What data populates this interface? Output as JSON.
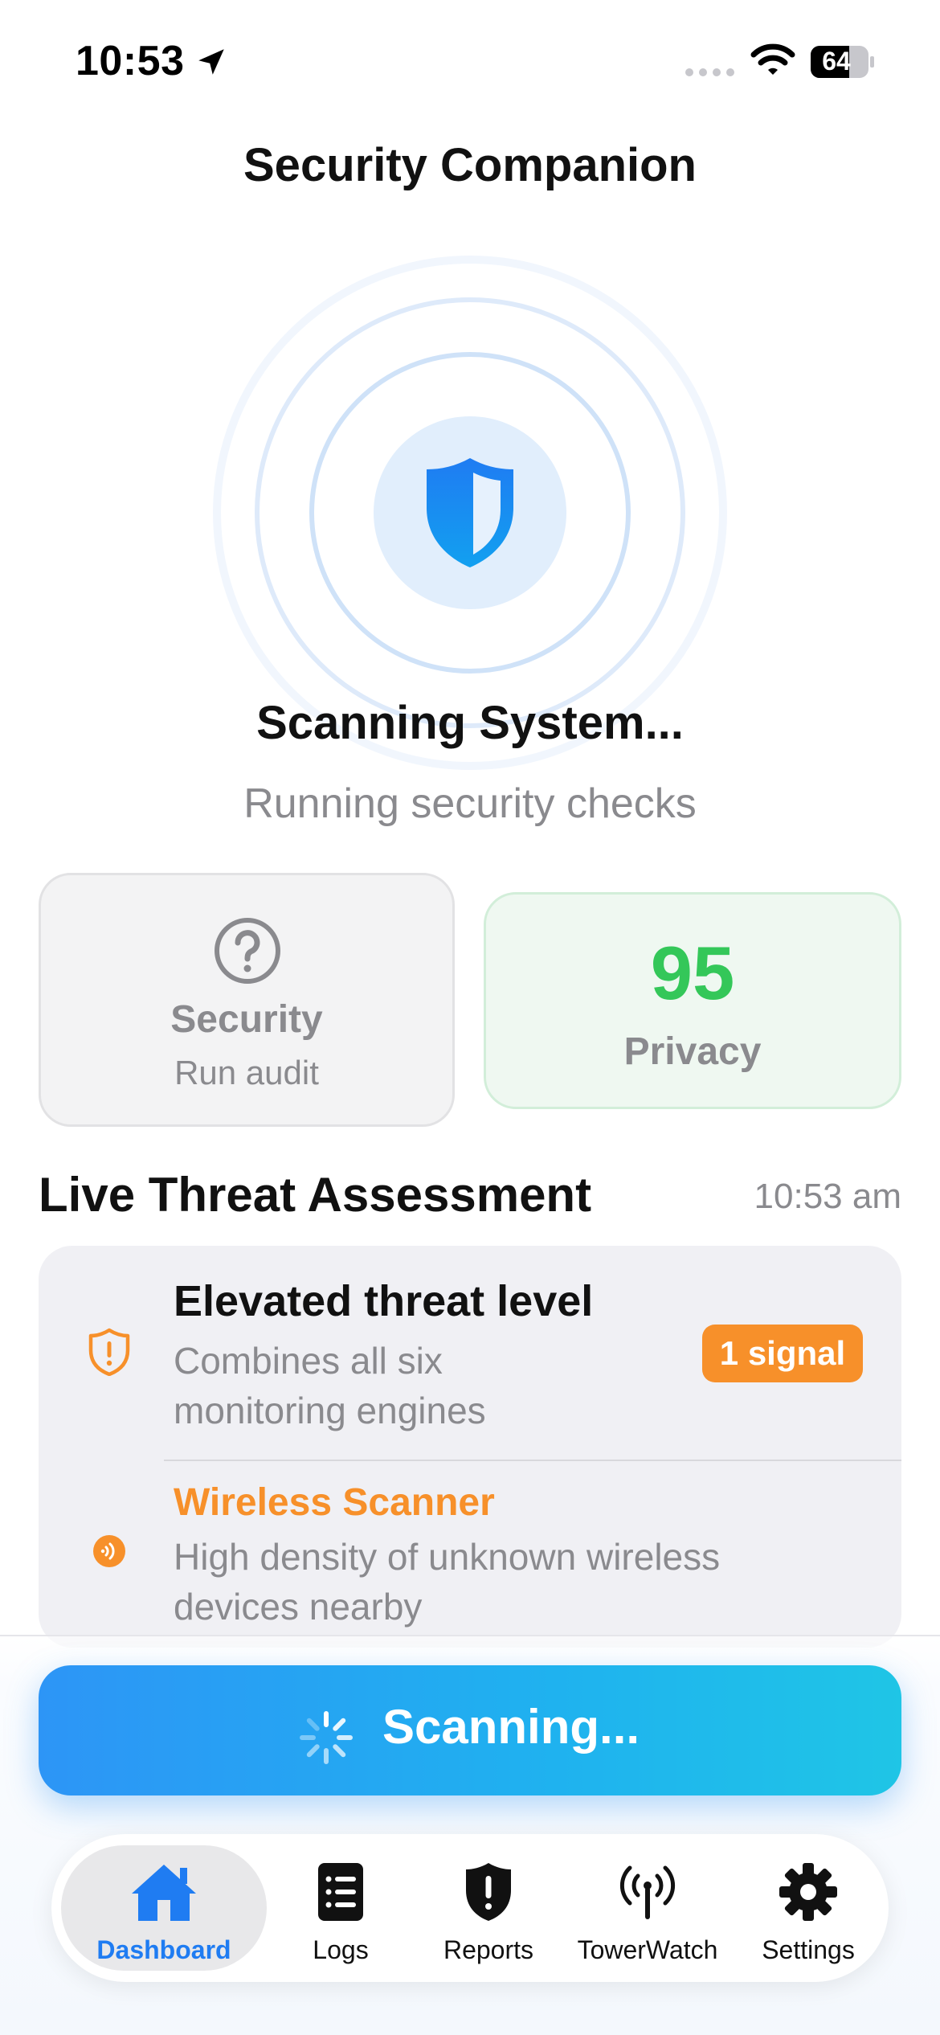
{
  "status_bar": {
    "time": "10:53",
    "battery": "64"
  },
  "header": {
    "title": "Security Companion"
  },
  "scanner": {
    "title": "Scanning System...",
    "subtitle": "Running security checks"
  },
  "cards": {
    "security": {
      "label": "Security",
      "sub": "Run audit"
    },
    "privacy": {
      "score": "95",
      "label": "Privacy"
    }
  },
  "threat": {
    "title": "Live Threat Assessment",
    "time": "10:53 am",
    "summary": {
      "title": "Elevated threat level",
      "description": "Combines all six monitoring engines",
      "badge": "1 signal"
    },
    "signals": [
      {
        "title": "Wireless Scanner",
        "description": "High density of unknown wireless devices nearby"
      }
    ]
  },
  "scan_button": {
    "label": "Scanning..."
  },
  "tabs": [
    {
      "label": "Dashboard",
      "icon": "house-icon"
    },
    {
      "label": "Logs",
      "icon": "list-icon"
    },
    {
      "label": "Reports",
      "icon": "shield-alert-icon"
    },
    {
      "label": "TowerWatch",
      "icon": "antenna-icon"
    },
    {
      "label": "Settings",
      "icon": "gear-icon"
    }
  ],
  "colors": {
    "accent": "#1f7cf2",
    "success": "#34c759",
    "warning": "#f7902a",
    "muted": "#8a8a8e"
  }
}
